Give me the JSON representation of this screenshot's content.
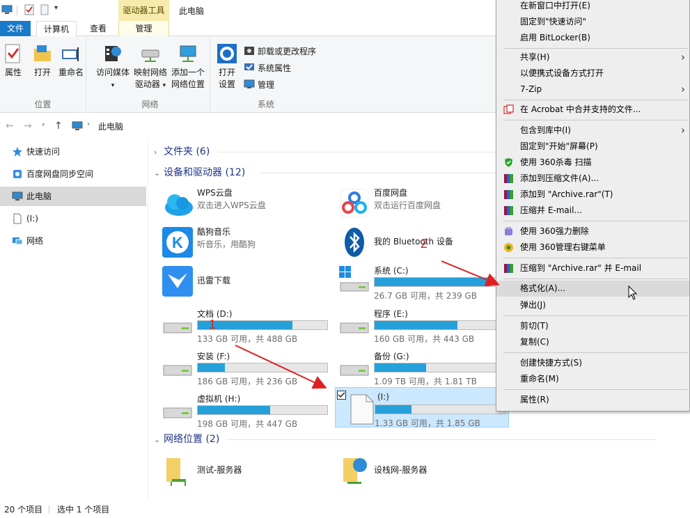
{
  "window": {
    "title": "此电脑",
    "context_tab": "驱动器工具"
  },
  "tabs": {
    "file": "文件",
    "computer": "计算机",
    "view": "查看",
    "manage": "管理"
  },
  "ribbon": {
    "location": {
      "label": "位置",
      "properties": "属性",
      "open": "打开",
      "rename": "重命名"
    },
    "network": {
      "label": "网络",
      "access_media": "访问媒体",
      "map_drive_1": "映射网络",
      "map_drive_2": "驱动器",
      "add_location_1": "添加一个",
      "add_location_2": "网络位置"
    },
    "system": {
      "label": "系统",
      "open_settings_1": "打开",
      "open_settings_2": "设置",
      "uninstall": "卸载或更改程序",
      "system_properties": "系统属性",
      "manage": "管理"
    }
  },
  "address": {
    "path": "此电脑"
  },
  "nav": {
    "items": [
      {
        "label": "快速访问"
      },
      {
        "label": "百度网盘同步空间"
      },
      {
        "label": "此电脑"
      },
      {
        "label": "(I:)"
      },
      {
        "label": "网络"
      }
    ]
  },
  "content": {
    "folders_group": "文件夹 (6)",
    "devices_group": "设备和驱动器 (12)",
    "network_group": "网络位置 (2)",
    "apps": [
      {
        "name": "WPS云盘",
        "sub": "双击进入WPS云盘"
      },
      {
        "name": "百度网盘",
        "sub": "双击运行百度网盘"
      },
      {
        "name": "酷狗音乐",
        "sub": "听音乐，用酷狗"
      },
      {
        "name": "我的 Bluetooth 设备",
        "sub": ""
      },
      {
        "name": "迅雷下载",
        "sub": ""
      }
    ],
    "drives": [
      {
        "name": "系统 (C:)",
        "free": "26.7 GB 可用，共 239 GB",
        "used_fraction": 0.89
      },
      {
        "name": "文档 (D:)",
        "free": "133 GB 可用，共 488 GB",
        "used_fraction": 0.73
      },
      {
        "name": "程序 (E:)",
        "free": "160 GB 可用，共 443 GB",
        "used_fraction": 0.64
      },
      {
        "name": "安装 (F:)",
        "free": "186 GB 可用，共 236 GB",
        "used_fraction": 0.21
      },
      {
        "name": "备份 (G:)",
        "free": "1.09 TB 可用，共 1.81 TB",
        "used_fraction": 0.4
      },
      {
        "name": "虚拟机 (H:)",
        "free": "198 GB 可用，共 447 GB",
        "used_fraction": 0.56
      },
      {
        "name": "(I:)",
        "free": "1.33 GB 可用，共 1.85 GB",
        "used_fraction": 0.28
      }
    ],
    "network_locations": [
      {
        "name": "测试-服务器"
      },
      {
        "name": "设栈网-服务器"
      }
    ]
  },
  "status": {
    "count": "20 个项目",
    "selected": "选中 1 个项目"
  },
  "context_menu": {
    "items": [
      "在新窗口中打开(E)",
      "固定到\"快速访问\"",
      "启用 BitLocker(B)",
      "共享(H)",
      "以便携式设备方式打开",
      "7-Zip",
      "在 Acrobat 中合并支持的文件...",
      "包含到库中(I)",
      "固定到\"开始\"屏幕(P)",
      "使用 360杀毒 扫描",
      "添加到压缩文件(A)...",
      "添加到 \"Archive.rar\"(T)",
      "压缩并 E-mail...",
      "使用 360强力删除",
      "使用 360管理右键菜单",
      "压缩到 \"Archive.rar\" 并 E-mail",
      "格式化(A)...",
      "弹出(J)",
      "剪切(T)",
      "复制(C)",
      "创建快捷方式(S)",
      "重命名(M)",
      "属性(R)"
    ]
  },
  "annotations": {
    "step1": "1",
    "step2": "2"
  },
  "colors": {
    "accent": "#1979ca",
    "drive_bar": "#26a0da",
    "selection": "#cce8ff",
    "annotation": "#e02020"
  }
}
